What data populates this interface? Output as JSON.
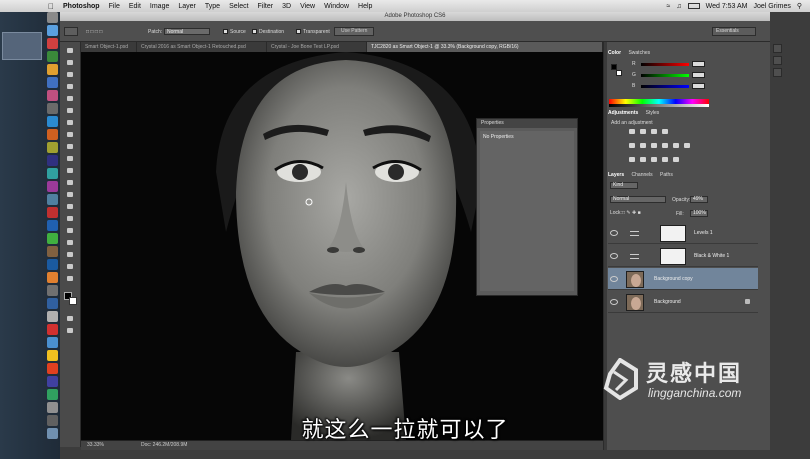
{
  "menubar": {
    "app_name": "Photoshop",
    "items": [
      "File",
      "Edit",
      "Image",
      "Layer",
      "Type",
      "Select",
      "Filter",
      "3D",
      "View",
      "Window",
      "Help"
    ],
    "clock": "Wed 7:53 AM",
    "user": "Joel Grimes"
  },
  "window_title": "Adobe Photoshop CS6",
  "options_bar": {
    "patch_label": "Patch:",
    "patch_value": "Normal",
    "source_label": "Source",
    "destination_label": "Destination",
    "transparent_label": "Transparent",
    "use_pattern_label": "Use Pattern",
    "workspace": "Essentials"
  },
  "doc_tabs": [
    "Smart Object-1.psd",
    "Crystal 2016 as Smart Object-1 Retouched.psd",
    "Crystal - Joe Bone Test LP.psd",
    "TJC2820 as Smart Object-1 @ 33.3% (Background copy, RGB/16)"
  ],
  "status": {
    "zoom": "33.33%",
    "doc_size": "Doc: 246.2M/208.9M"
  },
  "properties": {
    "title": "Properties",
    "content": "No Properties"
  },
  "color_panel": {
    "tabs": [
      "Color",
      "Swatches"
    ],
    "channels": [
      "R",
      "G",
      "B"
    ],
    "values": [
      "0",
      "0",
      "0"
    ],
    "fg": "#000000",
    "bg": "#ffffff"
  },
  "adjustments_panel": {
    "tabs": [
      "Adjustments",
      "Styles"
    ],
    "add_label": "Add an adjustment"
  },
  "layers_panel": {
    "tabs": [
      "Layers",
      "Channels",
      "Paths"
    ],
    "kind_filter": "Kind",
    "blend_mode": "Normal",
    "opacity_label": "Opacity:",
    "opacity_value": "49%",
    "lock_label": "Lock:",
    "fill_label": "Fill:",
    "fill_value": "100%",
    "layers": [
      {
        "name": "Levels 1"
      },
      {
        "name": "Black & White 1"
      },
      {
        "name": "Background copy"
      },
      {
        "name": "Background"
      }
    ]
  },
  "subtitle": "就这么一拉就可以了",
  "watermark": {
    "cn": "灵感中国",
    "en": "lingganchina.com"
  },
  "colors": {
    "panel": "#4e4e4e",
    "canvas": "#060606",
    "selected_layer": "#71859b",
    "desktop": "#1f2b38"
  }
}
